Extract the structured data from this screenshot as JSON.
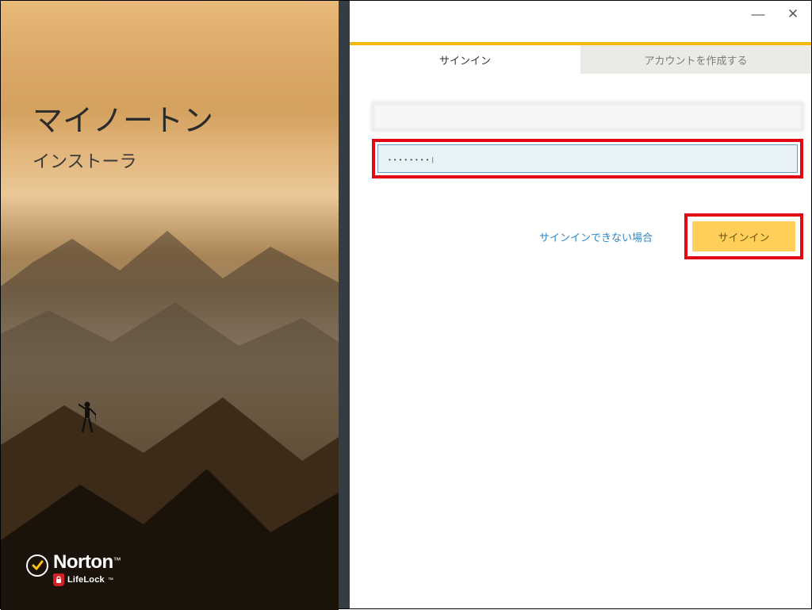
{
  "left": {
    "title": "マイノートン",
    "subtitle": "インストーラ",
    "brand": "Norton",
    "brand_tm": "™",
    "sub_brand": "LifeLock",
    "sub_brand_tm": "™"
  },
  "window": {
    "minimize": "—",
    "close": "✕"
  },
  "tabs": {
    "signin": "サインイン",
    "create": "アカウントを作成する"
  },
  "form": {
    "password_value": "••••••••|"
  },
  "actions": {
    "help_link": "サインインできない場合",
    "signin_button": "サインイン"
  }
}
